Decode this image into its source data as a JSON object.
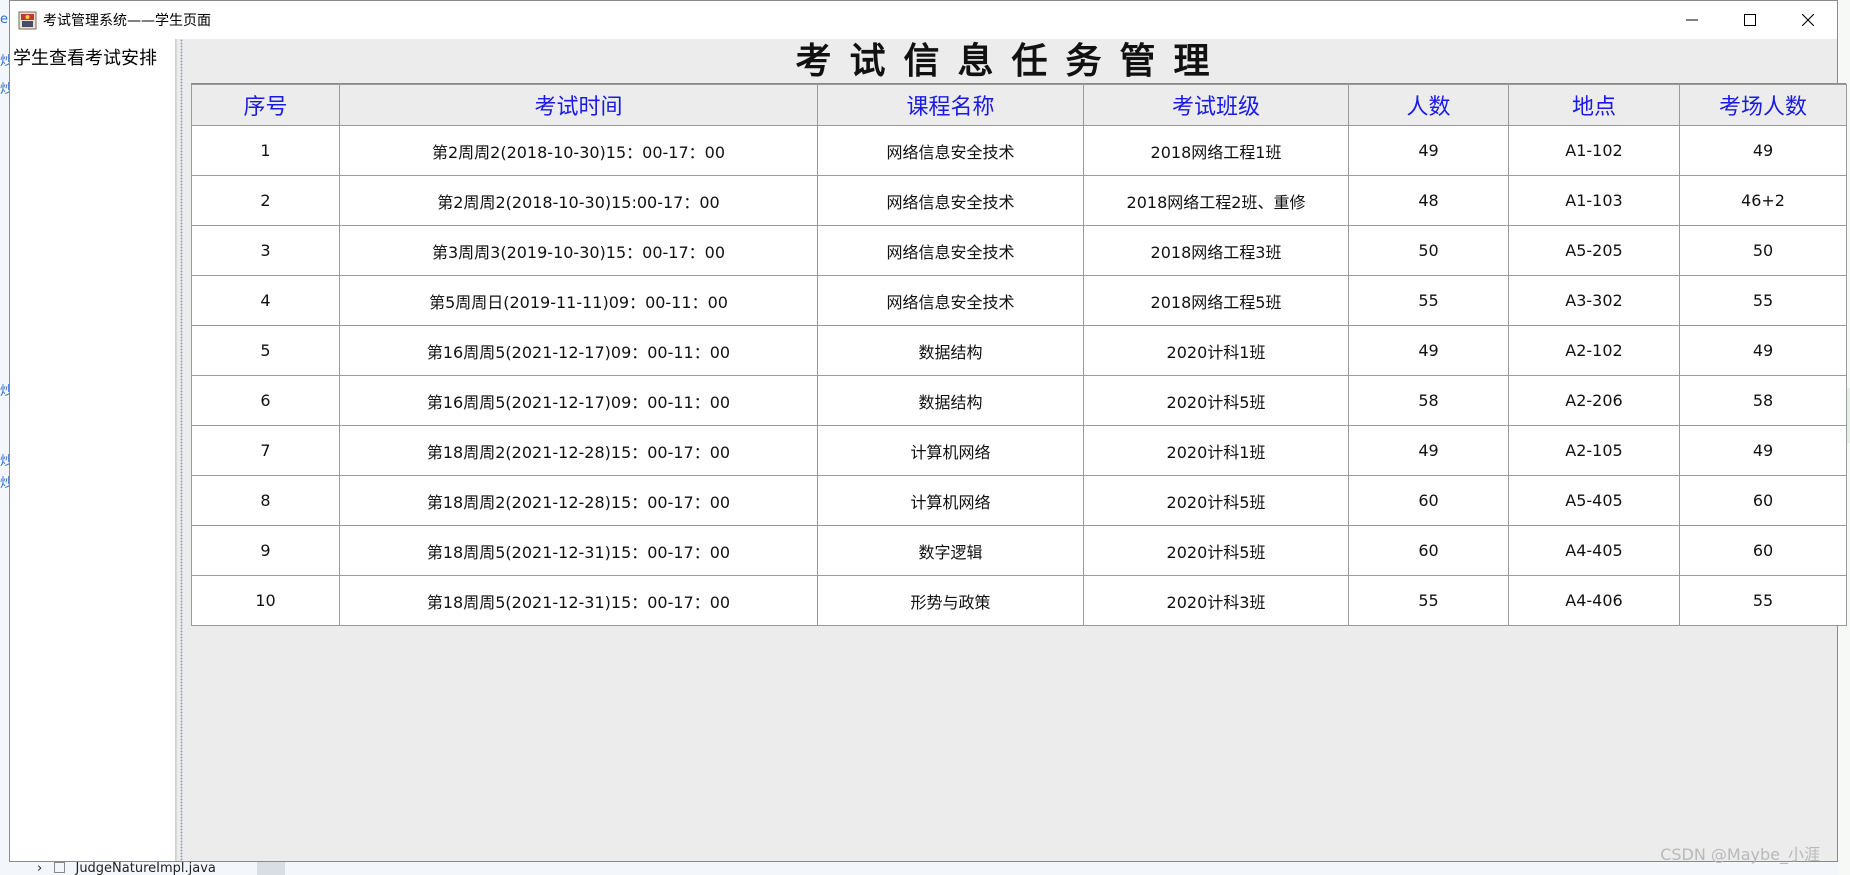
{
  "window": {
    "title": "考试管理系统——学生页面"
  },
  "sidebar": {
    "items": [
      {
        "label": "学生查看考试安排"
      }
    ]
  },
  "main": {
    "title": "考试信息任务管理",
    "table": {
      "headers": [
        "序号",
        "考试时间",
        "课程名称",
        "考试班级",
        "人数",
        "地点",
        "考场人数"
      ],
      "rows": [
        [
          "1",
          "第2周周2(2018-10-30)15：00-17：00",
          "网络信息安全技术",
          "2018网络工程1班",
          "49",
          "A1-102",
          "49"
        ],
        [
          "2",
          "第2周周2(2018-10-30)15:00-17：00",
          "网络信息安全技术",
          "2018网络工程2班、重修",
          "48",
          "A1-103",
          "46+2"
        ],
        [
          "3",
          "第3周周3(2019-10-30)15：00-17：00",
          "网络信息安全技术",
          "2018网络工程3班",
          "50",
          "A5-205",
          "50"
        ],
        [
          "4",
          "第5周周日(2019-11-11)09：00-11：00",
          "网络信息安全技术",
          "2018网络工程5班",
          "55",
          "A3-302",
          "55"
        ],
        [
          "5",
          "第16周周5(2021-12-17)09：00-11：00",
          "数据结构",
          "2020计科1班",
          "49",
          "A2-102",
          "49"
        ],
        [
          "6",
          "第16周周5(2021-12-17)09：00-11：00",
          "数据结构",
          "2020计科5班",
          "58",
          "A2-206",
          "58"
        ],
        [
          "7",
          "第18周周2(2021-12-28)15：00-17：00",
          "计算机网络",
          "2020计科1班",
          "49",
          "A2-105",
          "49"
        ],
        [
          "8",
          "第18周周2(2021-12-28)15：00-17：00",
          "计算机网络",
          "2020计科5班",
          "60",
          "A5-405",
          "60"
        ],
        [
          "9",
          "第18周周5(2021-12-31)15：00-17：00",
          "数字逻辑",
          "2020计科5班",
          "60",
          "A4-405",
          "60"
        ],
        [
          "10",
          "第18周周5(2021-12-31)15：00-17：00",
          "形势与政策",
          "2020计科3班",
          "55",
          "A4-406",
          "55"
        ]
      ]
    }
  },
  "background": {
    "left_marks": [
      "e",
      "炒",
      "炒",
      "炒",
      "炒",
      "炒"
    ],
    "tree_item": "JudgeNatureImpl.java"
  },
  "watermark": "CSDN @Maybe_小涯",
  "colors": {
    "header_text": "#1a1ae6",
    "window_bg": "#ececec"
  },
  "icons": [
    "app-icon",
    "minimize-icon",
    "maximize-icon",
    "close-icon"
  ]
}
